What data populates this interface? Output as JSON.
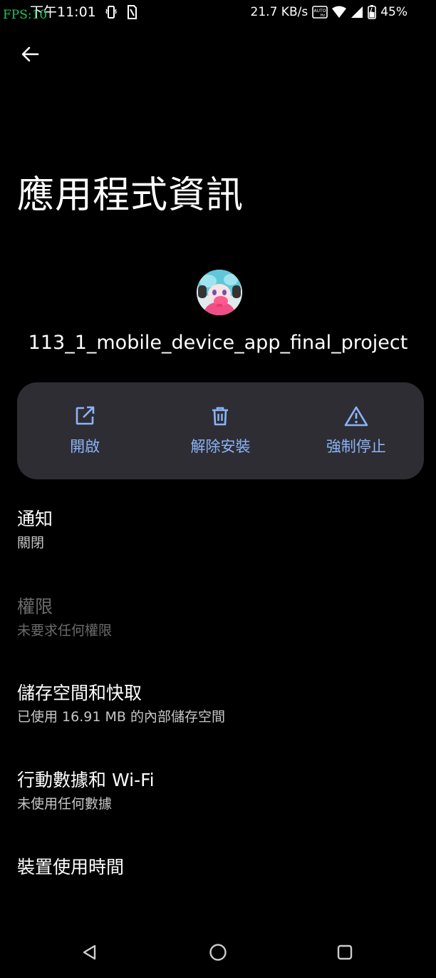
{
  "status_bar": {
    "fps": "FPS:10",
    "time": "下午11:01",
    "net_speed": "21.7 KB/s",
    "battery": "45%",
    "icons": [
      "vibrate-icon",
      "sim-card-icon",
      "auto-hz-icon",
      "wifi-icon",
      "cell-signal-icon",
      "battery-icon"
    ]
  },
  "header": {
    "back_icon": "arrow-left-icon",
    "title": "應用程式資訊"
  },
  "app": {
    "name": "113_1_mobile_device_app_final_project"
  },
  "actions": [
    {
      "label": "開啟",
      "icon": "open-external-icon"
    },
    {
      "label": "解除安裝",
      "icon": "trash-icon"
    },
    {
      "label": "強制停止",
      "icon": "warning-icon"
    }
  ],
  "settings": [
    {
      "title": "通知",
      "subtitle": "關閉"
    },
    {
      "title": "權限",
      "subtitle": "未要求任何權限"
    },
    {
      "title": "儲存空間和快取",
      "subtitle": "已使用 16.91 MB 的內部儲存空間"
    },
    {
      "title": "行動數據和 Wi-Fi",
      "subtitle": "未使用任何數據"
    },
    {
      "title": "裝置使用時間"
    }
  ],
  "nav": {
    "icons": [
      "back-triangle-icon",
      "home-circle-icon",
      "recents-square-icon"
    ]
  },
  "colors": {
    "background": "#000000",
    "card": "#2e2d33",
    "accent": "#8ab4f8",
    "disabled_text": "#6b6b6b"
  }
}
